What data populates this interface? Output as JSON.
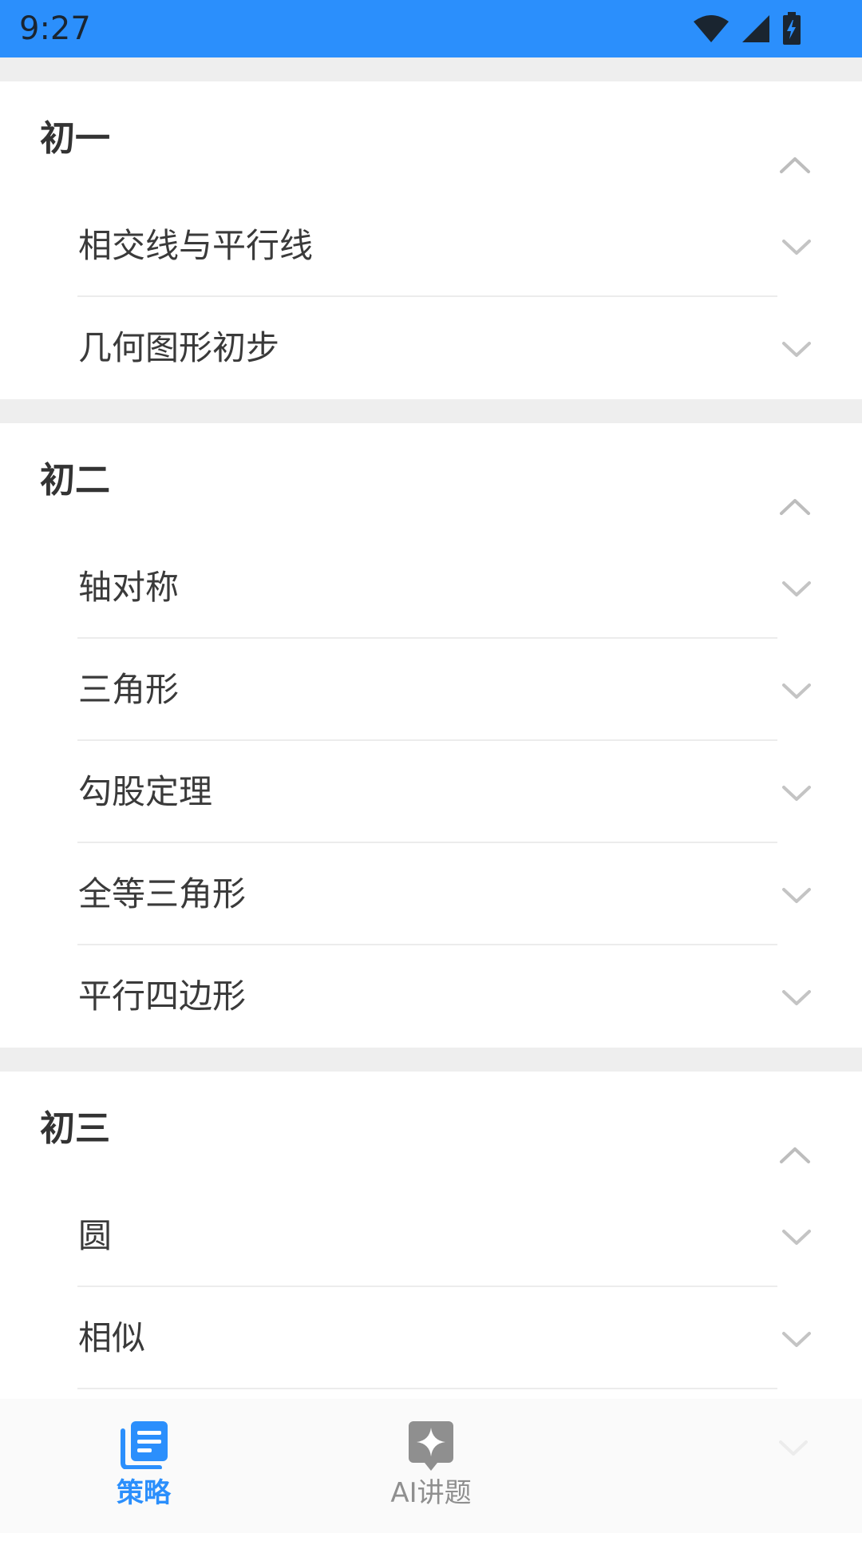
{
  "status_bar": {
    "time": "9:27",
    "icons": [
      "wifi-icon",
      "cellular-signal-icon",
      "battery-charging-icon"
    ]
  },
  "sections": [
    {
      "title": "初一",
      "expanded": true,
      "items": [
        {
          "label": "相交线与平行线"
        },
        {
          "label": "几何图形初步"
        }
      ]
    },
    {
      "title": "初二",
      "expanded": true,
      "items": [
        {
          "label": "轴对称"
        },
        {
          "label": "三角形"
        },
        {
          "label": "勾股定理"
        },
        {
          "label": "全等三角形"
        },
        {
          "label": "平行四边形"
        }
      ]
    },
    {
      "title": "初三",
      "expanded": true,
      "items": [
        {
          "label": "圆"
        },
        {
          "label": "相似"
        }
      ]
    }
  ],
  "bottom_nav": {
    "tabs": [
      {
        "label": "策略",
        "icon": "strategy-doc-icon",
        "active": true
      },
      {
        "label": "AI讲题",
        "icon": "ai-sparkle-icon",
        "active": false
      }
    ]
  },
  "colors": {
    "accent": "#2b8ffc",
    "status_bar": "#2b8ffc",
    "inactive_tab": "#8f8f8f",
    "chevron": "#bdbdbd"
  }
}
